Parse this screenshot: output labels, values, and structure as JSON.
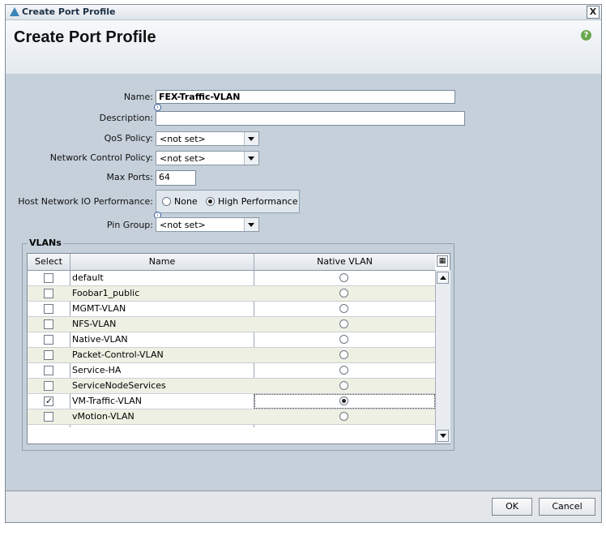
{
  "window": {
    "title": "Create Port Profile",
    "close_label": "X"
  },
  "header": {
    "title": "Create Port Profile",
    "help_label": "?"
  },
  "form": {
    "name_label": "Name:",
    "name_value": "FEX-Traffic-VLAN",
    "description_label": "Description:",
    "description_value": "",
    "qos_label": "QoS Policy:",
    "qos_value": "<not set>",
    "ncp_label": "Network Control Policy:",
    "ncp_value": "<not set>",
    "maxports_label": "Max Ports:",
    "maxports_value": "64",
    "hnio_label": "Host Network IO Performance:",
    "hnio_options": [
      "None",
      "High Performance"
    ],
    "hnio_selected": "High Performance",
    "pingroup_label": "Pin Group:",
    "pingroup_value": "<not set>"
  },
  "vlans": {
    "legend": "VLANs",
    "columns": [
      "Select",
      "Name",
      "Native VLAN"
    ],
    "rows": [
      {
        "name": "default",
        "selected": false,
        "native": false
      },
      {
        "name": "Foobar1_public",
        "selected": false,
        "native": false
      },
      {
        "name": "MGMT-VLAN",
        "selected": false,
        "native": false
      },
      {
        "name": "NFS-VLAN",
        "selected": false,
        "native": false
      },
      {
        "name": "Native-VLAN",
        "selected": false,
        "native": false
      },
      {
        "name": "Packet-Control-VLAN",
        "selected": false,
        "native": false
      },
      {
        "name": "Service-HA",
        "selected": false,
        "native": false
      },
      {
        "name": "ServiceNodeServices",
        "selected": false,
        "native": false
      },
      {
        "name": "VM-Traffic-VLAN",
        "selected": true,
        "native": true
      },
      {
        "name": "vMotion-VLAN",
        "selected": false,
        "native": false
      }
    ]
  },
  "footer": {
    "ok_label": "OK",
    "cancel_label": "Cancel"
  }
}
